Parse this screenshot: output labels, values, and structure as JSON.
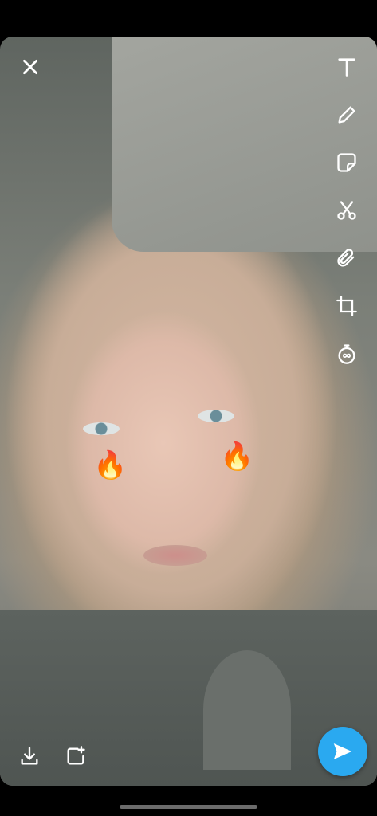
{
  "snap": {
    "stickers": [
      {
        "name": "fire-sticker-left",
        "glyph": "🔥"
      },
      {
        "name": "fire-sticker-right",
        "glyph": "🔥"
      }
    ]
  },
  "tools": [
    "text-icon",
    "pencil-icon",
    "sticker-icon",
    "scissors-icon",
    "paperclip-icon",
    "crop-icon",
    "timer-icon"
  ],
  "colors": {
    "send_button": "#2aa9f0",
    "icon": "#ffffff"
  }
}
